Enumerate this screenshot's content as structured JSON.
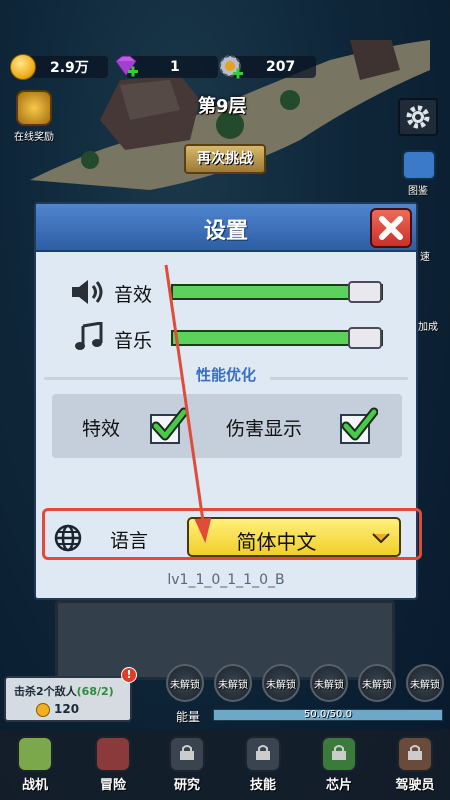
{
  "resources": {
    "coins": "2.9万",
    "gems": "1",
    "parts": "207"
  },
  "stage": {
    "level_title": "第9层",
    "retry_label": "再次挑战",
    "online_reward_label": "在线奖励",
    "codex_label": "图鉴",
    "side_label_speed": "速",
    "side_label_boost": "加成"
  },
  "settings": {
    "title": "设置",
    "sound_label": "音效",
    "sound_level": 0.82,
    "music_label": "音乐",
    "music_level": 0.82,
    "section_title": "性能优化",
    "effects_label": "特效",
    "effects_checked": true,
    "damage_label": "伤害显示",
    "damage_checked": true,
    "language_label": "语言",
    "language_value": "简体中文",
    "version": "lv1_1_0_1_1_0_B"
  },
  "task": {
    "text": "击杀2个敌人",
    "progress": "(68/2)",
    "reward": "120",
    "badge": "!"
  },
  "skills": [
    "未解锁",
    "未解锁",
    "未解锁",
    "未解锁",
    "未解锁",
    "未解锁"
  ],
  "energy": {
    "label": "能量",
    "value": "50.0/50.0"
  },
  "nav": [
    "战机",
    "冒险",
    "研究",
    "技能",
    "芯片",
    "驾驶员"
  ],
  "colors": {
    "header_blue": "#3f73bd",
    "slider_green": "#5cd25c",
    "close_red": "#d9403a",
    "select_yellow": "#f5d93a",
    "annotation_red": "#e04b3a"
  }
}
